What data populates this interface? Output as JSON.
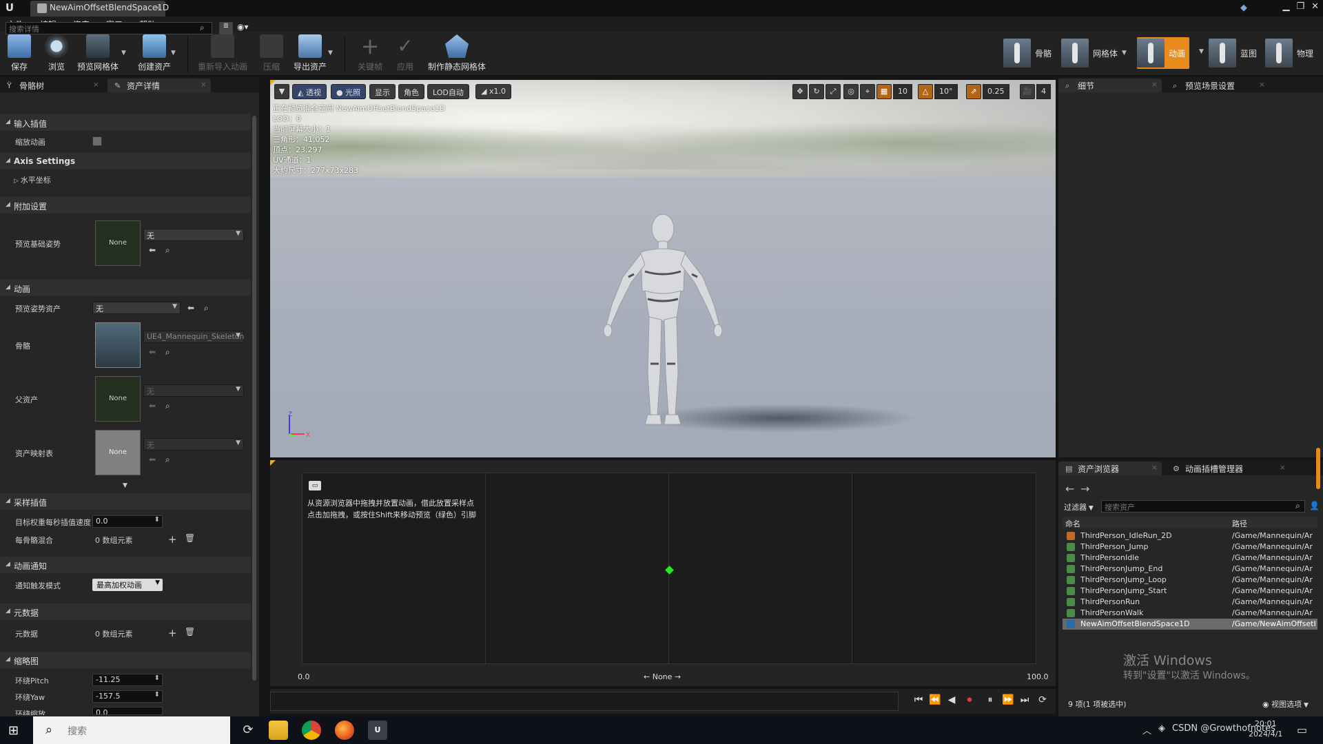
{
  "window": {
    "tab_title": "NewAimOffsetBlendSpace1D",
    "app_logo": "U"
  },
  "menu": [
    "文件",
    "编辑",
    "资产",
    "窗口",
    "帮助"
  ],
  "toolbar": {
    "save": "保存",
    "browse": "浏览",
    "preview_mesh": "预览网格体",
    "create_asset": "创建资产",
    "reimport": "重新导入动画",
    "compress": "压缩",
    "export_asset": "导出资产",
    "keyframe": "关键帧",
    "apply": "应用",
    "make_static_mesh": "制作静态网格体"
  },
  "modes": {
    "skeleton": "骨骼",
    "mesh": "网格体",
    "animation": "动画",
    "blueprint": "蓝图",
    "physics": "物理"
  },
  "left_panel": {
    "tabs": [
      "骨骼树",
      "资产详情"
    ],
    "search_placeholder": "搜索详情",
    "categories": {
      "input_interp": "输入插值",
      "axis_settings": "Axis Settings",
      "additive": "附加设置",
      "animation": "动画",
      "sample_interp": "采样插值",
      "anim_notify": "动画通知",
      "metadata": "元数据",
      "thumbnail": "缩略图"
    },
    "props": {
      "scale_anim": "缩放动画",
      "horizontal_axis": "水平坐标",
      "preview_base_pose": "预览基础姿势",
      "preview_pose_asset": "预览姿势资产",
      "skeleton": "骨骼",
      "parent_asset": "父资产",
      "asset_mapping": "资产映射表",
      "target_weight_speed": "目标权重每秒插值速度",
      "per_bone_blend": "每骨骼混合",
      "notify_mode": "通知触发模式",
      "metadata_label": "元数据",
      "orbit_pitch": "环绕Pitch",
      "orbit_yaw": "环绕Yaw",
      "orbit_zoom": "环绕缩放"
    },
    "values": {
      "none": "None",
      "wu": "无",
      "skeleton_name": "UE4_Mannequin_Skeleton",
      "target_weight_speed": "0.0",
      "array_elements": "0 数组元素",
      "notify_mode": "最高加权动画",
      "orbit_pitch": "-11.25",
      "orbit_yaw": "-157.5",
      "orbit_zoom": "0.0"
    }
  },
  "viewport": {
    "buttons": {
      "perspective": "透视",
      "lit": "光照",
      "show": "显示",
      "character": "角色",
      "lod": "LOD自动",
      "speed": "x1.0"
    },
    "snap": {
      "grid": "10",
      "angle": "10°",
      "scale": "0.25",
      "camera_speed": "4"
    },
    "info": [
      "正在预览混合空间 NewAimOffsetBlendSpace1D",
      "LOD：0",
      "当前屏幕大小：1",
      "三角形：41,052",
      "顶点：23,297",
      "UV通道：1",
      "大约尺寸：277x73x283"
    ],
    "axis_z": "Z",
    "axis_x": "X"
  },
  "blendspace": {
    "hint_line1": "从资源浏览器中拖拽并放置动画，借此放置采样点",
    "hint_line2": "点击加拖拽，或按住Shift来移动预览（绿色）引脚",
    "axis_min": "0.0",
    "axis_max": "100.0",
    "axis_name": "None",
    "preview_point": 0.5
  },
  "right_panel": {
    "top_tabs": [
      "细节",
      "预览场景设置"
    ],
    "bottom_tabs": [
      "资产浏览器",
      "动画插槽管理器"
    ],
    "filter": "过滤器",
    "search_placeholder": "搜索资产",
    "col_name": "命名",
    "col_path": "路径",
    "assets": [
      {
        "name": "ThirdPerson_IdleRun_2D",
        "path": "/Game/Mannequin/Ar",
        "kind": "orange"
      },
      {
        "name": "ThirdPerson_Jump",
        "path": "/Game/Mannequin/Ar",
        "kind": "green"
      },
      {
        "name": "ThirdPersonIdle",
        "path": "/Game/Mannequin/Ar",
        "kind": "green"
      },
      {
        "name": "ThirdPersonJump_End",
        "path": "/Game/Mannequin/Ar",
        "kind": "green"
      },
      {
        "name": "ThirdPersonJump_Loop",
        "path": "/Game/Mannequin/Ar",
        "kind": "green"
      },
      {
        "name": "ThirdPersonJump_Start",
        "path": "/Game/Mannequin/Ar",
        "kind": "green"
      },
      {
        "name": "ThirdPersonRun",
        "path": "/Game/Mannequin/Ar",
        "kind": "green"
      },
      {
        "name": "ThirdPersonWalk",
        "path": "/Game/Mannequin/Ar",
        "kind": "green"
      },
      {
        "name": "NewAimOffsetBlendSpace1D",
        "path": "/Game/NewAimOffsetI",
        "kind": "blue",
        "selected": true
      }
    ],
    "watermark_title": "激活 Windows",
    "watermark_sub": "转到\"设置\"以激活 Windows。",
    "count": "9 项(1 项被选中)",
    "view_options": "视图选项"
  },
  "taskbar": {
    "search_placeholder": "搜索",
    "tray_text": "CSDN @Growthofnotes",
    "time": "20:01",
    "date": "2024/4/1"
  }
}
